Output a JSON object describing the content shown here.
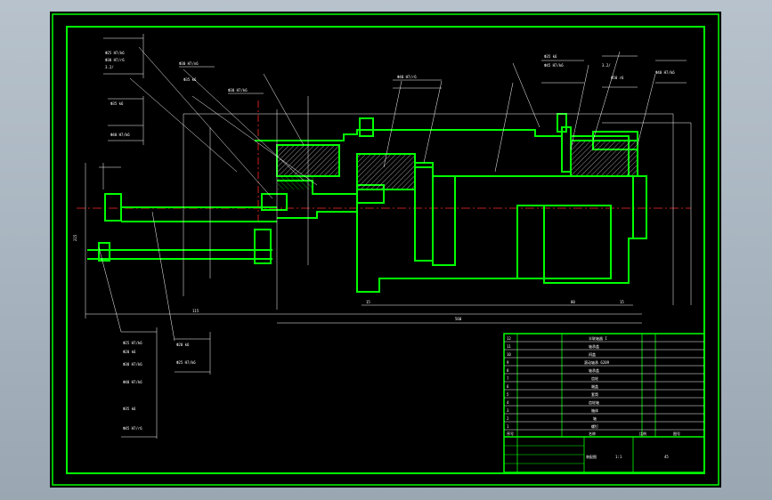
{
  "title_block": {
    "parts_list": [
      {
        "no": "12",
        "name": "半联轴器 I"
      },
      {
        "no": "11",
        "name": "轴承盖"
      },
      {
        "no": "10",
        "name": "闷盖"
      },
      {
        "no": "9",
        "name": "滚动轴承 6209"
      },
      {
        "no": "8",
        "name": "轴承盖"
      },
      {
        "no": "7",
        "name": "齿轮"
      },
      {
        "no": "6",
        "name": "端盖"
      },
      {
        "no": "5",
        "name": "套筒"
      },
      {
        "no": "4",
        "name": "齿轮轴"
      },
      {
        "no": "3",
        "name": "箱体"
      },
      {
        "no": "2",
        "name": "轴"
      },
      {
        "no": "1",
        "name": "螺钉"
      }
    ],
    "header": {
      "no": "序号",
      "name": "名称"
    },
    "bottom_label_a": "比例",
    "bottom_label_b": "图号",
    "scale": "1:1",
    "drawing_name": "装配图",
    "material": "45"
  },
  "callouts": {
    "top_left": [
      "Ф25 H7/k6",
      "Ф30 H7/r6",
      "3.2/",
      "Ф35 k6",
      "Ф40 H7/k6"
    ],
    "top_mid": [
      "Ф30 H7/n6",
      "Ф35 k6",
      "Ф30 H7/k6",
      "Ф40 H7/r6"
    ],
    "top_right": [
      "Ф35 k6",
      "Ф45 H7/k6",
      "3.2/",
      "Ф50 r6",
      "Ф40 H7/k6"
    ],
    "bottom_left": [
      "Ф25 H7/k6",
      "Ф20 k6",
      "Ф30 H7/k6",
      "Ф40 H7/k6",
      "Ф35 k6",
      "Ф45 H7/r6"
    ],
    "bottom_mid": [
      "Ф20 k6",
      "Ф25 H7/k6"
    ]
  },
  "dimensions": {
    "overall_length": "560",
    "seg_a": "15",
    "seg_b": "115",
    "seg_c": "80",
    "seg_d": "15",
    "height": "215"
  }
}
